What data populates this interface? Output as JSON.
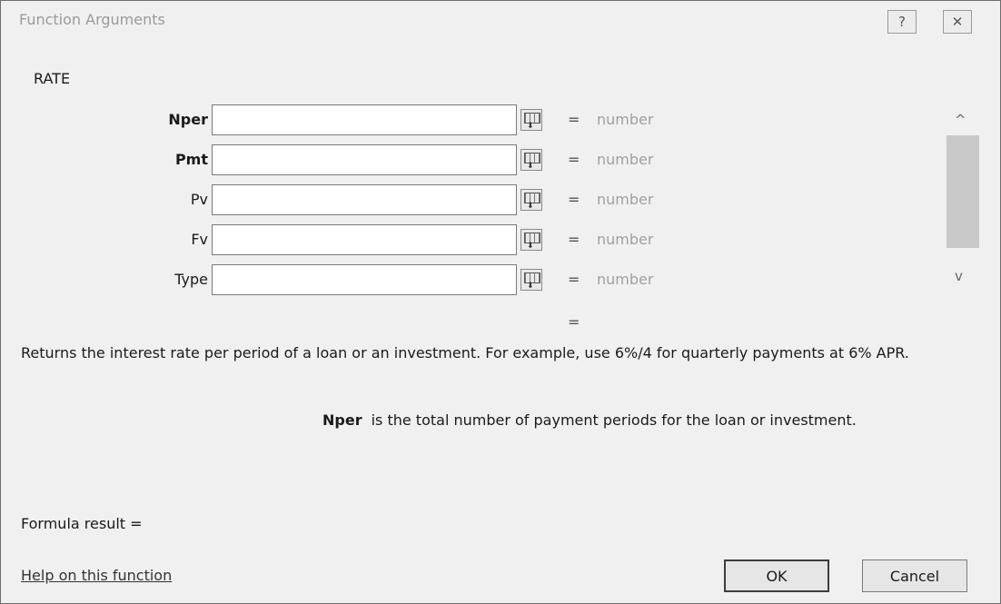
{
  "window": {
    "title": "Function Arguments",
    "help_glyph": "?",
    "close_glyph": "✕"
  },
  "function_name": "RATE",
  "arguments": [
    {
      "label": "Nper",
      "bold": true,
      "value": "",
      "equals": "=",
      "result": "number"
    },
    {
      "label": "Pmt",
      "bold": true,
      "value": "",
      "equals": "=",
      "result": "number"
    },
    {
      "label": "Pv",
      "bold": false,
      "value": "",
      "equals": "=",
      "result": "number"
    },
    {
      "label": "Fv",
      "bold": false,
      "value": "",
      "equals": "=",
      "result": "number"
    },
    {
      "label": "Type",
      "bold": false,
      "value": "",
      "equals": "=",
      "result": "number"
    }
  ],
  "scrollbar": {
    "up_glyph": "^",
    "down_glyph": "v"
  },
  "result_equals": "=",
  "description": "Returns the interest rate per period of a loan or an investment. For example, use 6%/4 for quarterly payments at 6% APR.",
  "arg_help": {
    "name": "Nper",
    "text": "is the total number of payment periods for the loan or investment."
  },
  "formula_result": "Formula result =",
  "help_link": "Help on this function",
  "buttons": {
    "ok": "OK",
    "cancel": "Cancel"
  },
  "icons": {
    "help": "help-icon",
    "close": "close-icon",
    "collapse": "collapse-dialog-icon",
    "scroll_up": "chevron-up-icon",
    "scroll_down": "chevron-down-icon"
  }
}
